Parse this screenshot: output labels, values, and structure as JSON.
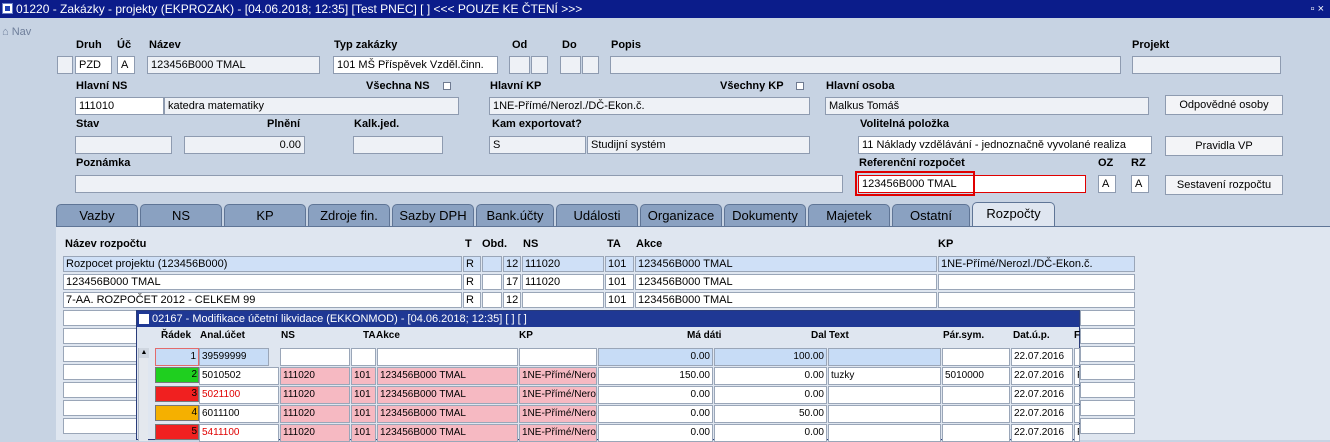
{
  "window": {
    "title": "01220 - Zakázky - projekty (EKPROZAK) - [04.06.2018; 12:35]  [Test PNEC]  [ ] <<< POUZE KE ČTENÍ >>>",
    "controls": "▫ ×"
  },
  "nav": {
    "label": "Nav"
  },
  "header": {
    "druh_label": "Druh",
    "druh_value": "PZD",
    "uc_label": "Úč",
    "uc_value": "A",
    "nazev_label": "Název",
    "nazev_value": "123456B000 TMAL",
    "typ_label": "Typ zakázky",
    "typ_value": "101 MŠ Příspěvek Vzděl.činn.",
    "od_label": "Od",
    "do_label": "Do",
    "popis_label": "Popis",
    "projekt_label": "Projekt",
    "hlavni_ns_label": "Hlavní NS",
    "hlavni_ns_code": "111010",
    "hlavni_ns_name": "katedra matematiky",
    "vsechna_ns_label": "Všechna NS",
    "hlavni_kp_label": "Hlavní KP",
    "hlavni_kp_value": "1NE-Přímé/Nerozl./DČ-Ekon.č.",
    "vsechny_kp_label": "Všechny KP",
    "hlavni_osoba_label": "Hlavní osoba",
    "hlavni_osoba_value": "Malkus Tomáš",
    "odpovedne_osoby_button": "Odpovědné osoby",
    "stav_label": "Stav",
    "plneni_label": "Plnění",
    "plneni_value": "0.00",
    "kalk_label": "Kalk.jed.",
    "kam_label": "Kam exportovat?",
    "kam_code": "S",
    "kam_name": "Studijní systém",
    "volitelna_label": "Volitelná položka",
    "volitelna_value": "11 Náklady vzdělávání - jednoznačně vyvolané realiza",
    "pravidla_button": "Pravidla VP",
    "poznamka_label": "Poznámka",
    "ref_rozpocet_label": "Referenční rozpočet",
    "ref_rozpocet_value": "123456B000 TMAL",
    "oz_label": "OZ",
    "oz_value": "A",
    "rz_label": "RZ",
    "rz_value": "A",
    "sestaveni_button": "Sestavení rozpočtu"
  },
  "tabs": [
    "Vazby",
    "NS",
    "KP",
    "Zdroje fin.",
    "Sazby DPH",
    "Bank.účty",
    "Události",
    "Organizace",
    "Dokumenty",
    "Majetek",
    "Ostatní",
    "Rozpočty"
  ],
  "grid": {
    "headers": {
      "nazev": "Název rozpočtu",
      "t": "T",
      "obd": "Obd.",
      "ns": "NS",
      "ta": "TA",
      "akce": "Akce",
      "kp": "KP"
    },
    "rows": [
      {
        "nazev": "Rozpocet projektu (123456B000)",
        "t": "R",
        "obd": "12",
        "ns": "111020",
        "ta": "101",
        "akce": "123456B000 TMAL",
        "kp": "1NE-Přímé/Nerozl./DČ-Ekon.č."
      },
      {
        "nazev": "123456B000 TMAL",
        "t": "R",
        "obd": "17",
        "ns": "111020",
        "ta": "101",
        "akce": "123456B000 TMAL",
        "kp": ""
      },
      {
        "nazev": "7-AA. ROZPOČET 2012 - CELKEM 99",
        "t": "R",
        "obd": "12",
        "ns": "",
        "ta": "101",
        "akce": "123456B000 TMAL",
        "kp": ""
      }
    ]
  },
  "subwindow": {
    "title": "02167 - Modifikace účetní likvidace (EKKONMOD) - [04.06.2018; 12:35]  [ ]  [ ]",
    "headers": {
      "radek": "Řádek",
      "anal": "Anal.účet",
      "ns": "NS",
      "ta": "TA",
      "akce": "Akce",
      "kp": "KP",
      "ma_dati": "Má dáti",
      "dal": "Dal",
      "text": "Text",
      "par": "Pár.sym.",
      "dat": "Dat.ú.p.",
      "f": "F"
    },
    "rows": [
      {
        "n": "1",
        "color": "#ffffff",
        "anal": "39599999",
        "ns": "",
        "ta": "",
        "akce": "",
        "kp": "",
        "ma_dati": "0.00",
        "dal": "100.00",
        "text": "",
        "par": "",
        "dat": "22.07.2016",
        "f": ""
      },
      {
        "n": "2",
        "color": "#1fcf1f",
        "anal": "5010502",
        "ns": "111020",
        "ta": "101",
        "akce": "123456B000 TMAL",
        "kp": "1NE-Přímé/Nero",
        "ma_dati": "150.00",
        "dal": "0.00",
        "text": "tuzky",
        "par": "5010000",
        "dat": "22.07.2016",
        "f": "F"
      },
      {
        "n": "3",
        "color": "#f02020",
        "anal": "5021100",
        "ns": "111020",
        "ta": "101",
        "akce": "123456B000 TMAL",
        "kp": "1NE-Přímé/Nero",
        "ma_dati": "0.00",
        "dal": "0.00",
        "text": "",
        "par": "",
        "dat": "22.07.2016",
        "f": ""
      },
      {
        "n": "4",
        "color": "#f5b000",
        "anal": "6011100",
        "ns": "111020",
        "ta": "101",
        "akce": "123456B000 TMAL",
        "kp": "1NE-Přímé/Nero",
        "ma_dati": "0.00",
        "dal": "50.00",
        "text": "",
        "par": "",
        "dat": "22.07.2016",
        "f": ""
      },
      {
        "n": "5",
        "color": "#f02020",
        "anal": "5411100",
        "ns": "111020",
        "ta": "101",
        "akce": "123456B000 TMAL",
        "kp": "1NE-Přímé/Nero",
        "ma_dati": "0.00",
        "dal": "0.00",
        "text": "",
        "par": "",
        "dat": "22.07.2016",
        "f": "F"
      }
    ]
  },
  "colors": {
    "title_bar": "#0b1c8a",
    "background": "#c7d3e3",
    "highlight": "#e00000"
  }
}
